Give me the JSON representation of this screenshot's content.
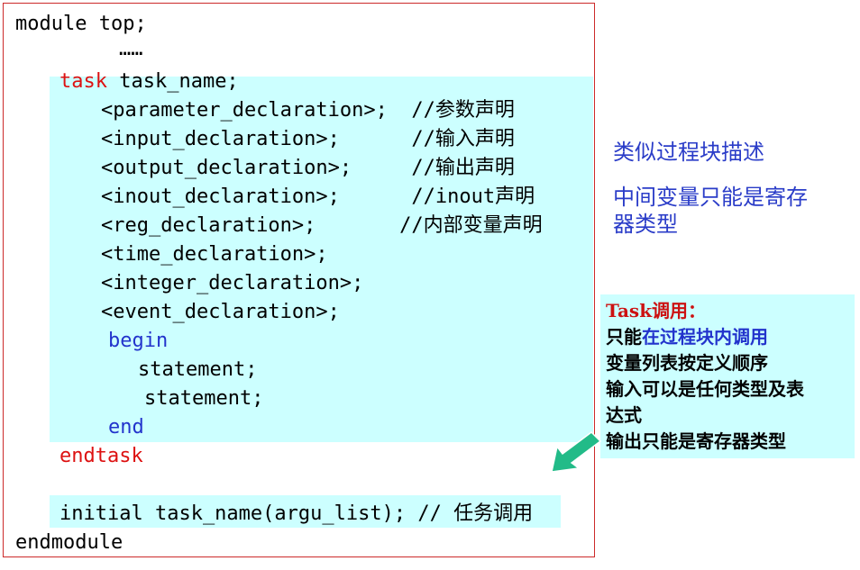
{
  "code": {
    "line_module": "module top;",
    "line_dots": "……",
    "line_task_kw": "task",
    "line_task_name": " task_name;",
    "line_param": "<parameter_declaration>;  //参数声明",
    "line_input": "<input_declaration>;      //输入声明",
    "line_output": "<output_declaration>;     //输出声明",
    "line_inout": "<inout_declaration>;      //inout声明",
    "line_reg": "<reg_declaration>;       //内部变量声明",
    "line_time": "<time_declaration>;",
    "line_integer": "<integer_declaration>;",
    "line_event": "<event_declaration>;",
    "line_begin": "begin",
    "line_stmt1": "statement;",
    "line_stmt2": "statement;",
    "line_end": "end",
    "line_endtask": "endtask",
    "line_call": "initial task_name(argu_list); // 任务调用",
    "line_endmodule": "endmodule"
  },
  "notes": {
    "note1": "类似过程块描述",
    "note2_line1": "中间变量只能是寄存",
    "note2_line2": "器类型"
  },
  "callout": {
    "title": "Task调用：",
    "line1_a": "只能",
    "line1_b": "在过程块内调用",
    "line2": "变量列表按定义顺序",
    "line3": "输入可以是任何类型及表",
    "line4": "达式",
    "line5": "输出只能是寄存器类型"
  },
  "colors": {
    "highlight_bg": "#ccffff",
    "keyword_red": "#dd1111",
    "keyword_blue": "#2233cc",
    "note_blue": "#2a3cc8",
    "border_red": "#cc2a2a",
    "arrow_green": "#22bb88"
  }
}
